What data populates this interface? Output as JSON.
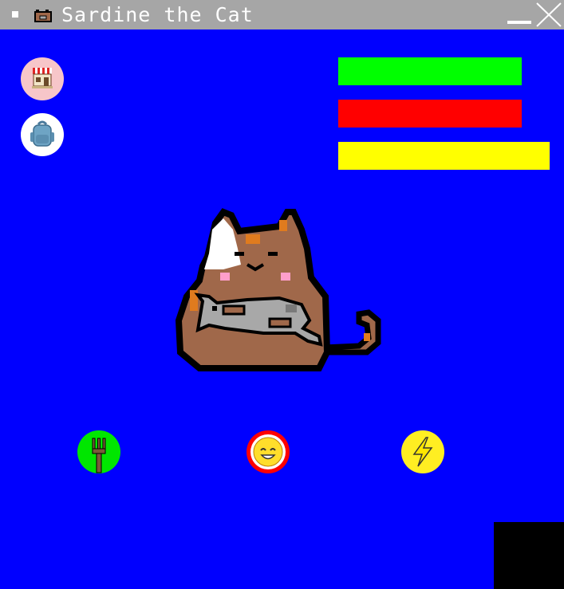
{
  "window": {
    "title": "Sardine the Cat",
    "app_icon": "cat-icon",
    "minimize_icon": "minimize-icon",
    "close_icon": "close-icon"
  },
  "side_buttons": [
    {
      "name": "shop",
      "icon": "shop-icon",
      "bg": "#f7c6c9"
    },
    {
      "name": "inventory",
      "icon": "backpack-icon",
      "bg": "#ffffff"
    }
  ],
  "stats": [
    {
      "name": "hunger",
      "level": 0.87,
      "color": "#00ff00"
    },
    {
      "name": "happiness",
      "level": 0.87,
      "color": "#ff0000"
    },
    {
      "name": "energy",
      "level": 1.0,
      "color": "#ffff00"
    }
  ],
  "actions": [
    {
      "name": "feed",
      "icon": "fork-icon",
      "bg": "#00e600"
    },
    {
      "name": "play",
      "icon": "smiley-icon",
      "bg": "#ffde2b",
      "ring": "#ff0000"
    },
    {
      "name": "sleep",
      "icon": "lightning-icon",
      "bg": "#ffee22"
    }
  ],
  "colors": {
    "background": "#0000ff",
    "titlebar": "#a6a6a6",
    "cat_fur": "#a0684a",
    "outline": "#000000"
  }
}
